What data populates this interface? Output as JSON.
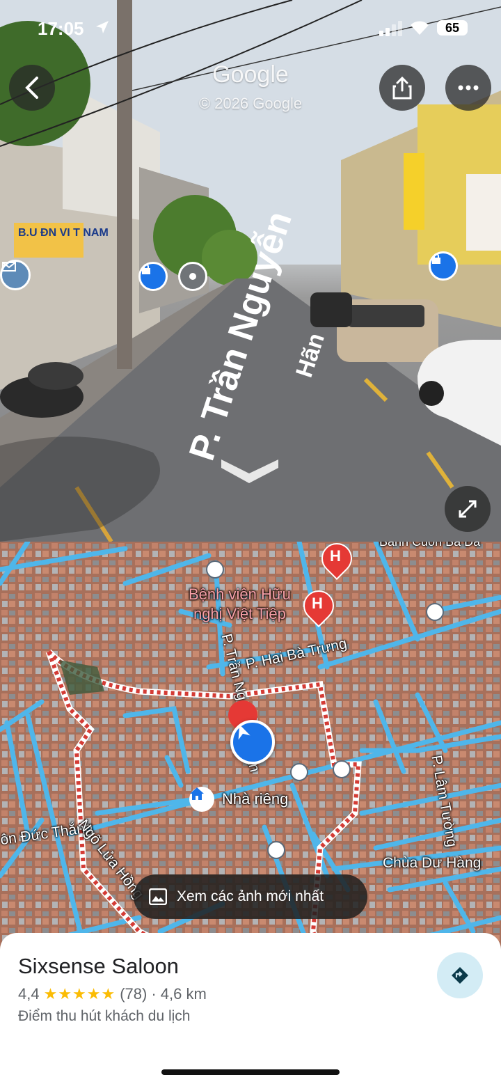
{
  "status_bar": {
    "time": "17:05",
    "battery": "65"
  },
  "street_view": {
    "brand": "Google",
    "copyright": "© 2026 Google",
    "road_label_1": "P. Trần Nguyễn",
    "road_label_2": "Hãn",
    "shop_sign": "B.U",
    "shop_sign_2": "ĐN VI T NAM"
  },
  "map": {
    "labels": {
      "hospital": "Bệnh viện Hữu\nnghị Việt Tiệp",
      "hospital_line1": "Bệnh viện Hữu",
      "hospital_line2": "nghị Việt Tiệp",
      "hai_ba_trung": "P. Hai Bà Trưng",
      "tran_ng": "P. Trần Ng",
      "han": "ãn",
      "home": "Nhà riêng",
      "ton_duc_thang": "ôn Đức Thắng",
      "ngo_lua_hong": "Ngõ Lửa Hồng",
      "lam_tuong": "P. Lâm Tường",
      "chua_du_hang": "Chùa Dư Hàng",
      "top_edge": "Bánh Cuốn Bà Đa"
    }
  },
  "photos_button": {
    "label": "Xem các ảnh mới nhất"
  },
  "place": {
    "name": "Sixsense Saloon",
    "rating": "4,4",
    "stars": "★★★★★",
    "reviews": "(78)",
    "distance": "· 4,6 km",
    "category": "Điểm thu hút khách du lịch"
  },
  "colors": {
    "road_blue": "#4fb6ea",
    "accent": "#1a73e8",
    "pin_red": "#e53935"
  }
}
